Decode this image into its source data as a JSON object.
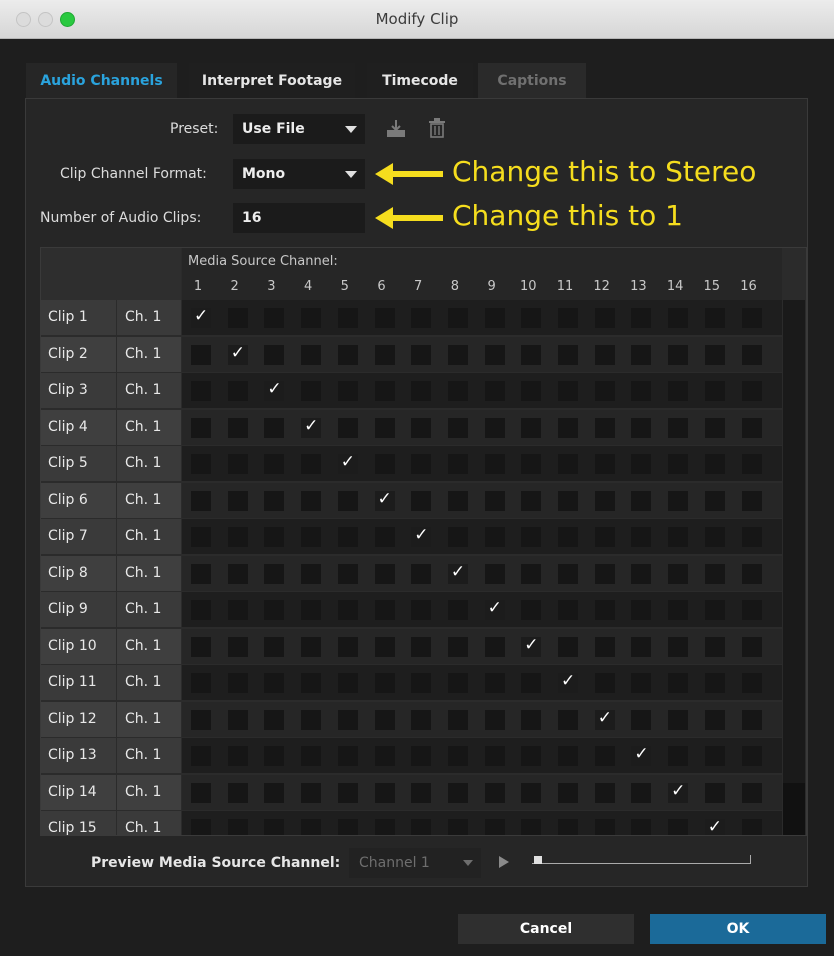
{
  "window": {
    "title": "Modify Clip"
  },
  "tabs": [
    {
      "label": "Audio Channels",
      "state": "active"
    },
    {
      "label": "Interpret Footage",
      "state": "normal"
    },
    {
      "label": "Timecode",
      "state": "normal"
    },
    {
      "label": "Captions",
      "state": "disabled"
    }
  ],
  "preset": {
    "label": "Preset:",
    "value": "Use File",
    "save_icon": "save-preset-icon",
    "delete_icon": "trash-icon"
  },
  "channel_format": {
    "label": "Clip Channel Format:",
    "value": "Mono"
  },
  "num_clips": {
    "label": "Number of Audio Clips:",
    "value": "16"
  },
  "annotations": {
    "format_note": "Change this to Stereo",
    "clips_note": "Change this to 1"
  },
  "grid": {
    "header_title": "Media Source Channel:",
    "columns": [
      "1",
      "2",
      "3",
      "4",
      "5",
      "6",
      "7",
      "8",
      "9",
      "10",
      "11",
      "12",
      "13",
      "14",
      "15",
      "16"
    ],
    "rows": [
      {
        "clip": "Clip 1",
        "ch": "Ch. 1",
        "checked": 1
      },
      {
        "clip": "Clip 2",
        "ch": "Ch. 1",
        "checked": 2
      },
      {
        "clip": "Clip 3",
        "ch": "Ch. 1",
        "checked": 3
      },
      {
        "clip": "Clip 4",
        "ch": "Ch. 1",
        "checked": 4
      },
      {
        "clip": "Clip 5",
        "ch": "Ch. 1",
        "checked": 5
      },
      {
        "clip": "Clip 6",
        "ch": "Ch. 1",
        "checked": 6
      },
      {
        "clip": "Clip 7",
        "ch": "Ch. 1",
        "checked": 7
      },
      {
        "clip": "Clip 8",
        "ch": "Ch. 1",
        "checked": 8
      },
      {
        "clip": "Clip 9",
        "ch": "Ch. 1",
        "checked": 9
      },
      {
        "clip": "Clip 10",
        "ch": "Ch. 1",
        "checked": 10
      },
      {
        "clip": "Clip 11",
        "ch": "Ch. 1",
        "checked": 11
      },
      {
        "clip": "Clip 12",
        "ch": "Ch. 1",
        "checked": 12
      },
      {
        "clip": "Clip 13",
        "ch": "Ch. 1",
        "checked": 13
      },
      {
        "clip": "Clip 14",
        "ch": "Ch. 1",
        "checked": 14
      },
      {
        "clip": "Clip 15",
        "ch": "Ch. 1",
        "checked": 15
      }
    ]
  },
  "preview": {
    "label": "Preview Media Source Channel:",
    "value": "Channel 1",
    "play_icon": "play-icon"
  },
  "buttons": {
    "cancel": "Cancel",
    "ok": "OK"
  },
  "colors": {
    "accent": "#2aa3dd",
    "annotation": "#f5dd1e",
    "ok_button": "#1b6a99"
  }
}
